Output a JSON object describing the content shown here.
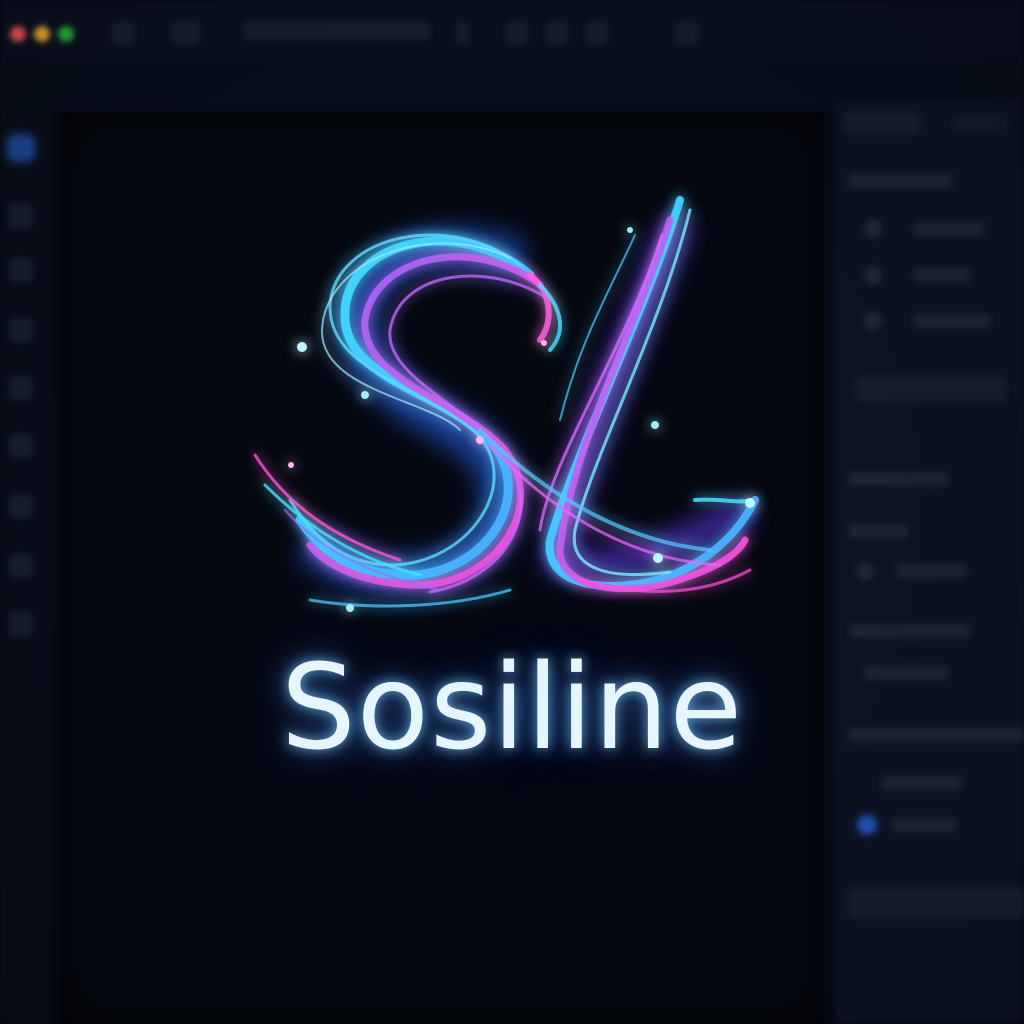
{
  "brand": {
    "name": "Sosiline",
    "monogram_icon": "sl-ribbon-monogram-icon",
    "colors": {
      "cyan": "#3fe2ff",
      "blue": "#4aa8ff",
      "magenta": "#e05cff",
      "violet": "#8a6bff",
      "text_glow": "#e6f6ff"
    }
  },
  "window": {
    "controls": [
      "close-icon",
      "minimize-icon",
      "maximize-icon"
    ],
    "control_colors": [
      "#ff5f57",
      "#febc2e",
      "#28c840"
    ]
  },
  "theme": {
    "background": "#05080f",
    "panel": "#0e1524",
    "accent": "#2a64d8"
  }
}
